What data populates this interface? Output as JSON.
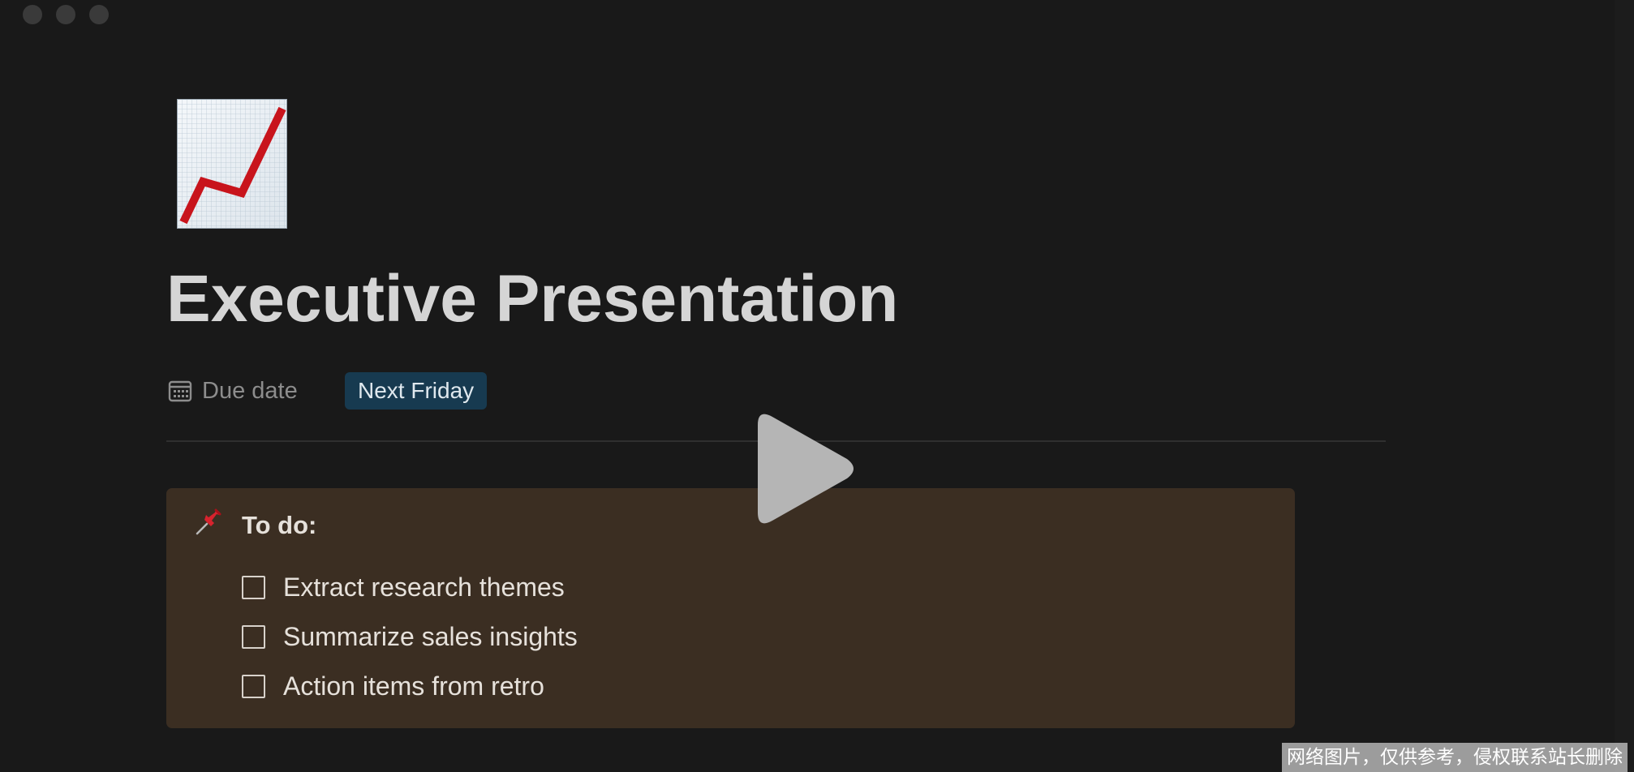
{
  "window": {
    "traffic_lights": [
      "close",
      "minimize",
      "maximize"
    ]
  },
  "page": {
    "icon": "chart-increasing-icon",
    "title": "Executive Presentation",
    "properties": [
      {
        "icon": "calendar-icon",
        "label": "Due date",
        "value": "Next Friday",
        "value_color": "#173a50"
      }
    ]
  },
  "callout": {
    "icon": "pushpin-icon",
    "title": "To do:",
    "background": "#3b2e22",
    "items": [
      {
        "text": "Extract research themes",
        "checked": false
      },
      {
        "text": "Summarize sales insights",
        "checked": false
      },
      {
        "text": "Action items from retro",
        "checked": false
      }
    ]
  },
  "overlay": {
    "icon": "play-icon"
  },
  "watermark": {
    "text": "网络图片，仅供参考，侵权联系站长删除"
  }
}
